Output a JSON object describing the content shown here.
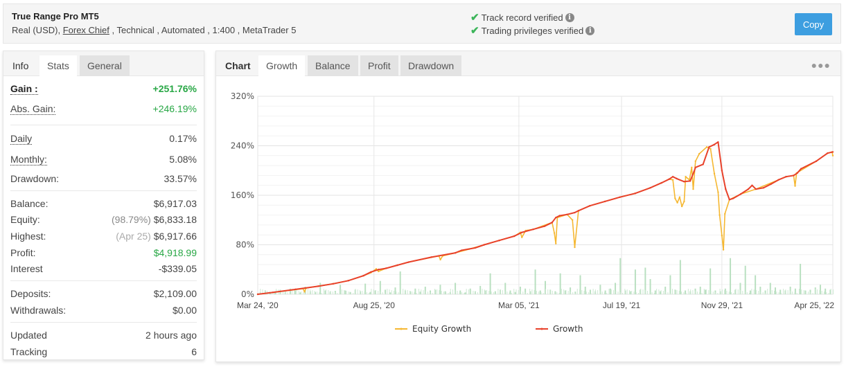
{
  "header": {
    "title": "True Range Pro MT5",
    "meta_prefix": "Real (USD),",
    "broker_link": "Forex Chief",
    "meta_suffix": " , Technical , Automated , 1:400 , MetaTrader 5",
    "verifications": [
      {
        "icon": "check-icon",
        "label": "Track record verified",
        "info_icon": "info-icon"
      },
      {
        "icon": "check-icon",
        "label": "Trading privileges verified",
        "info_icon": "info-icon"
      }
    ],
    "copy_button": "Copy",
    "colors": {
      "copy_button": "#3d9ee0",
      "verified_check": "#3cb55a"
    }
  },
  "stats_panel": {
    "tabs": [
      {
        "label": "Info",
        "state": "plain"
      },
      {
        "label": "Stats",
        "state": "active"
      },
      {
        "label": "General",
        "state": "grey"
      }
    ],
    "rows": {
      "gain": {
        "label": "Gain :",
        "value": "+251.76%"
      },
      "abs_gain": {
        "label": "Abs. Gain:",
        "value": "+246.19%"
      },
      "daily": {
        "label": "Daily",
        "value": "0.17%"
      },
      "monthly": {
        "label": "Monthly:",
        "value": "5.08%"
      },
      "drawdown": {
        "label": "Drawdown:",
        "value": "33.57%"
      },
      "balance": {
        "label": "Balance:",
        "value": "$6,917.03"
      },
      "equity": {
        "label": "Equity:",
        "prefix": "(98.79%)",
        "value": "$6,833.18"
      },
      "highest": {
        "label": "Highest:",
        "prefix": "(Apr 25)",
        "value": "$6,917.66"
      },
      "profit": {
        "label": "Profit:",
        "value": "$4,918.99"
      },
      "interest": {
        "label": "Interest",
        "value": "-$339.05"
      },
      "deposits": {
        "label": "Deposits:",
        "value": "$2,109.00"
      },
      "withdrawals": {
        "label": "Withdrawals:",
        "value": "$0.00"
      },
      "updated": {
        "label": "Updated",
        "value": "2 hours ago"
      },
      "tracking": {
        "label": "Tracking",
        "value": "6"
      }
    },
    "colors": {
      "positive": "#28a745"
    }
  },
  "chart_panel": {
    "tabs": [
      {
        "label": "Chart",
        "state": "plain"
      },
      {
        "label": "Growth",
        "state": "active"
      },
      {
        "label": "Balance",
        "state": "grey"
      },
      {
        "label": "Profit",
        "state": "grey"
      },
      {
        "label": "Drawdown",
        "state": "grey"
      }
    ],
    "more_icon": "more-horizontal-icon"
  },
  "chart_data": {
    "type": "line",
    "title": "",
    "xlabel": "",
    "ylabel": "",
    "ylim": [
      0,
      320
    ],
    "yticks": [
      "0%",
      "80%",
      "160%",
      "240%",
      "320%"
    ],
    "ytick_values": [
      0,
      80,
      160,
      240,
      320
    ],
    "xticks": [
      "Mar 24, '20",
      "Aug 25, '20",
      "Mar 05, '21",
      "Jul 19, '21",
      "Nov 29, '21",
      "Apr 25, '22"
    ],
    "x_range_days": [
      0,
      762
    ],
    "xtick_days": [
      0,
      154,
      346,
      482,
      615,
      762
    ],
    "grid": true,
    "legend_position": "bottom",
    "series": [
      {
        "name": "Growth",
        "color": "#e8412a",
        "points": [
          [
            0,
            0
          ],
          [
            20,
            3
          ],
          [
            50,
            8
          ],
          [
            80,
            13
          ],
          [
            100,
            17
          ],
          [
            120,
            22
          ],
          [
            140,
            30
          ],
          [
            150,
            36
          ],
          [
            160,
            40
          ],
          [
            170,
            42
          ],
          [
            185,
            47
          ],
          [
            200,
            52
          ],
          [
            230,
            60
          ],
          [
            262,
            67
          ],
          [
            270,
            71
          ],
          [
            288,
            75
          ],
          [
            300,
            80
          ],
          [
            320,
            87
          ],
          [
            340,
            94
          ],
          [
            350,
            100
          ],
          [
            365,
            105
          ],
          [
            380,
            110
          ],
          [
            390,
            116
          ],
          [
            395,
            124
          ],
          [
            400,
            127
          ],
          [
            410,
            129
          ],
          [
            420,
            132
          ],
          [
            425,
            135
          ],
          [
            440,
            143
          ],
          [
            460,
            150
          ],
          [
            480,
            157
          ],
          [
            500,
            163
          ],
          [
            520,
            172
          ],
          [
            535,
            180
          ],
          [
            545,
            186
          ],
          [
            550,
            190
          ],
          [
            555,
            187
          ],
          [
            565,
            182
          ],
          [
            573,
            183
          ],
          [
            578,
            198
          ],
          [
            580,
            205
          ],
          [
            590,
            210
          ],
          [
            598,
            238
          ],
          [
            605,
            242
          ],
          [
            610,
            246
          ],
          [
            615,
            200
          ],
          [
            620,
            170
          ],
          [
            625,
            153
          ],
          [
            630,
            155
          ],
          [
            640,
            162
          ],
          [
            650,
            170
          ],
          [
            655,
            176
          ],
          [
            660,
            170
          ],
          [
            670,
            172
          ],
          [
            680,
            178
          ],
          [
            690,
            185
          ],
          [
            700,
            190
          ],
          [
            710,
            192
          ],
          [
            715,
            196
          ],
          [
            720,
            203
          ],
          [
            740,
            215
          ],
          [
            755,
            228
          ],
          [
            762,
            230
          ]
        ]
      },
      {
        "name": "Equity Growth",
        "color": "#f5b731",
        "points": [
          [
            0,
            0
          ],
          [
            60,
            9
          ],
          [
            62,
            4
          ],
          [
            64,
            10
          ],
          [
            100,
            17
          ],
          [
            120,
            22
          ],
          [
            140,
            30
          ],
          [
            150,
            35
          ],
          [
            157,
            41
          ],
          [
            160,
            37
          ],
          [
            170,
            42
          ],
          [
            185,
            47
          ],
          [
            200,
            52
          ],
          [
            240,
            62
          ],
          [
            242,
            56
          ],
          [
            245,
            62
          ],
          [
            262,
            67
          ],
          [
            280,
            73
          ],
          [
            300,
            80
          ],
          [
            320,
            87
          ],
          [
            340,
            94
          ],
          [
            348,
            100
          ],
          [
            350,
            92
          ],
          [
            355,
            103
          ],
          [
            365,
            105
          ],
          [
            390,
            116
          ],
          [
            393,
            99
          ],
          [
            395,
            82
          ],
          [
            397,
            124
          ],
          [
            410,
            129
          ],
          [
            417,
            120
          ],
          [
            420,
            76
          ],
          [
            425,
            135
          ],
          [
            440,
            143
          ],
          [
            460,
            150
          ],
          [
            480,
            157
          ],
          [
            500,
            163
          ],
          [
            520,
            172
          ],
          [
            535,
            180
          ],
          [
            545,
            186
          ],
          [
            550,
            185
          ],
          [
            553,
            155
          ],
          [
            556,
            148
          ],
          [
            559,
            157
          ],
          [
            562,
            142
          ],
          [
            565,
            150
          ],
          [
            567,
            190
          ],
          [
            572,
            185
          ],
          [
            575,
            205
          ],
          [
            577,
            170
          ],
          [
            580,
            215
          ],
          [
            585,
            227
          ],
          [
            595,
            238
          ],
          [
            600,
            235
          ],
          [
            605,
            195
          ],
          [
            610,
            165
          ],
          [
            612,
            128
          ],
          [
            615,
            95
          ],
          [
            617,
            72
          ],
          [
            619,
            130
          ],
          [
            625,
            153
          ],
          [
            640,
            162
          ],
          [
            660,
            170
          ],
          [
            690,
            185
          ],
          [
            700,
            190
          ],
          [
            710,
            192
          ],
          [
            712,
            175
          ],
          [
            714,
            196
          ],
          [
            740,
            215
          ],
          [
            755,
            228
          ],
          [
            761,
            230
          ],
          [
            762,
            224
          ]
        ]
      }
    ],
    "volume_bars": {
      "name": "Daily volume",
      "color": "#b9e0c0",
      "note": "secondary bars along baseline; relative heights 0-1",
      "values": [
        0.05,
        0.1,
        0.06,
        0.08,
        0.12,
        0.07,
        0.15,
        0.1,
        0.05,
        0.2,
        0.08,
        0.06,
        0.3,
        0.1,
        0.07,
        0.09,
        0.25,
        0.1,
        0.06,
        0.12,
        0.08,
        0.28,
        0.06,
        0.1,
        0.35,
        0.12,
        0.05,
        0.18,
        0.6,
        0.1,
        0.08,
        0.15,
        0.07,
        0.2,
        0.1,
        0.12,
        0.25,
        0.08,
        0.06,
        0.3,
        0.1,
        0.05,
        0.15,
        0.08,
        0.22,
        0.1,
        0.55,
        0.08,
        0.12,
        0.3,
        0.1,
        0.06,
        0.2,
        0.15,
        0.08,
        0.65,
        0.1,
        0.35,
        0.12,
        0.08,
        0.55,
        0.1,
        0.18,
        0.07,
        0.5,
        0.2,
        0.12,
        0.08,
        0.25,
        0.1,
        0.15,
        0.3,
        0.95,
        0.1,
        0.08,
        0.65,
        0.12,
        0.7,
        0.4,
        0.1,
        0.08,
        0.2,
        0.5,
        0.12,
        0.9,
        0.1,
        0.08,
        0.15,
        0.2,
        0.12,
        0.68,
        0.1,
        0.08,
        0.15,
        0.95,
        0.12,
        0.3,
        0.75,
        0.1,
        0.5,
        0.2,
        0.1,
        0.3,
        0.18,
        0.12,
        0.1,
        0.2,
        0.15,
        0.8,
        0.1,
        0.12,
        0.18,
        0.25,
        0.15,
        0.12
      ]
    }
  }
}
